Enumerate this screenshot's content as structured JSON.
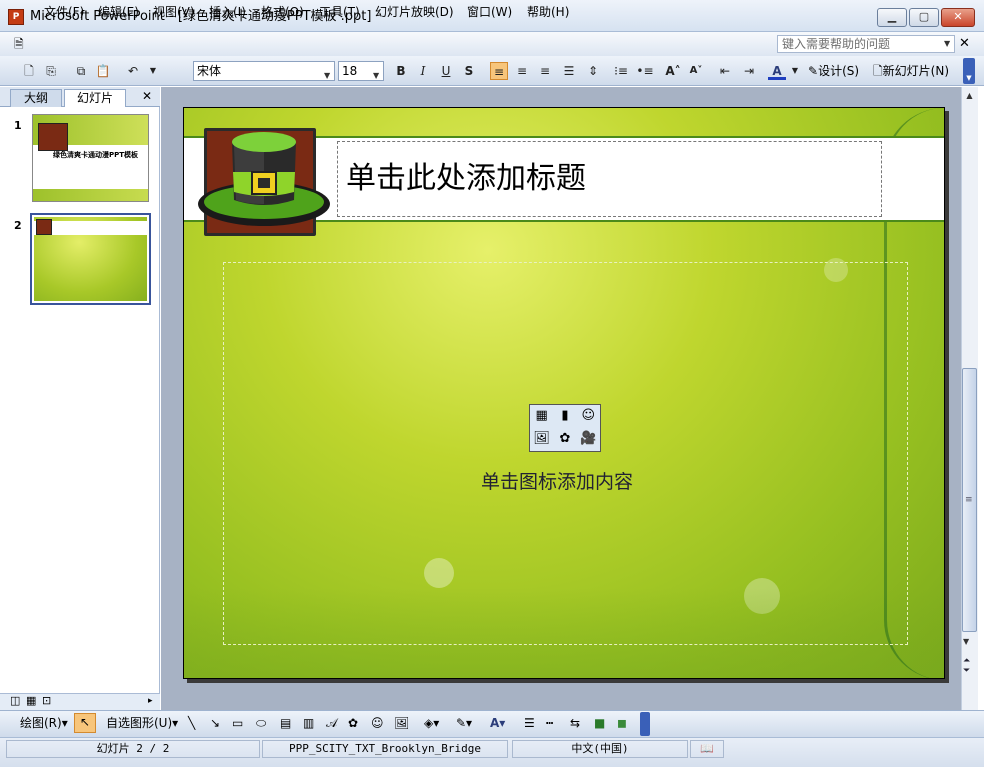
{
  "window": {
    "title": "Microsoft PowerPoint - [绿色清爽卡通动漫PPT模板 .ppt]",
    "icon_label": "P"
  },
  "menu": {
    "items": [
      "文件(F)",
      "编辑(E)",
      "视图(V)",
      "插入(I)",
      "格式(O)",
      "工具(T)",
      "幻灯片放映(D)",
      "窗口(W)",
      "帮助(H)"
    ],
    "help_placeholder": "键入需要帮助的问题"
  },
  "toolbar": {
    "font": "宋体",
    "size": "18",
    "design_label": "设计(S)",
    "new_slide_label": "新幻灯片(N)"
  },
  "left_pane": {
    "tabs": [
      "大纲",
      "幻灯片"
    ],
    "slide_numbers": [
      "1",
      "2"
    ],
    "thumb1_title": "绿色清爽卡通动漫PPT模板"
  },
  "slide": {
    "title_placeholder": "单击此处添加标题",
    "content_placeholder": "单击图标添加内容"
  },
  "draw_toolbar": {
    "draw_label": "绘图(R)",
    "autoshapes_label": "自选图形(U)"
  },
  "status": {
    "slide_info": "幻灯片 2 / 2",
    "design": "PPP_SCITY_TXT_Brooklyn_Bridge",
    "language": "中文(中国)"
  },
  "colors": {
    "titlebar": "#dbe5f2",
    "slide_green": "#a8c828",
    "band_border": "#4b8a1a",
    "thumb_selected": "#39549b"
  }
}
